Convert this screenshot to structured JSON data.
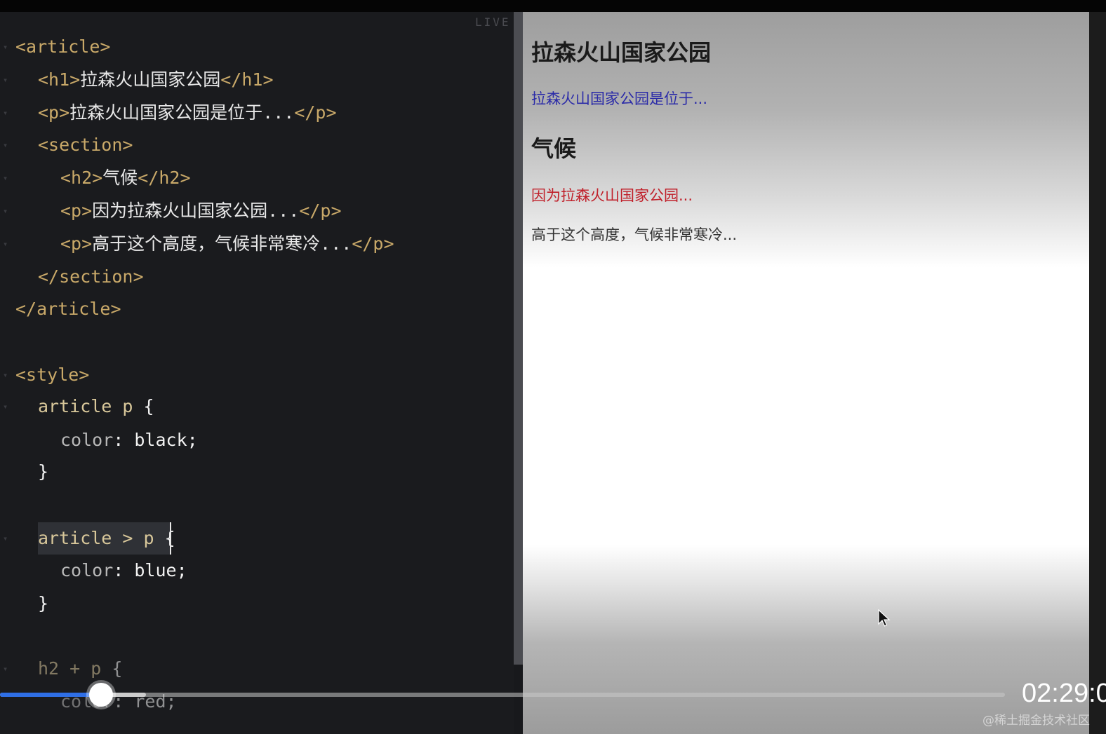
{
  "editor": {
    "live_label": "LIVE",
    "lines": [
      {
        "segments": [
          {
            "t": "<article>",
            "c": "c-tag"
          }
        ]
      },
      {
        "segments": [
          {
            "t": "<h1>",
            "c": "c-tag"
          },
          {
            "t": "拉森火山国家公园",
            "c": "c-txt"
          },
          {
            "t": "</h1>",
            "c": "c-tag"
          }
        ]
      },
      {
        "segments": [
          {
            "t": "<p>",
            "c": "c-tag"
          },
          {
            "t": "拉森火山国家公园是位于...",
            "c": "c-txt"
          },
          {
            "t": "</p>",
            "c": "c-tag"
          }
        ]
      },
      {
        "segments": [
          {
            "t": "<section>",
            "c": "c-tag"
          }
        ]
      },
      {
        "segments": [
          {
            "t": "<h2>",
            "c": "c-tag"
          },
          {
            "t": "气候",
            "c": "c-txt"
          },
          {
            "t": "</h2>",
            "c": "c-tag"
          }
        ]
      },
      {
        "segments": [
          {
            "t": "<p>",
            "c": "c-tag"
          },
          {
            "t": "因为拉森火山国家公园...",
            "c": "c-txt"
          },
          {
            "t": "</p>",
            "c": "c-tag"
          }
        ]
      },
      {
        "segments": [
          {
            "t": "<p>",
            "c": "c-tag"
          },
          {
            "t": "高于这个高度，气候非常寒冷...",
            "c": "c-txt"
          },
          {
            "t": "</p>",
            "c": "c-tag"
          }
        ]
      },
      {
        "segments": [
          {
            "t": "</section>",
            "c": "c-tag"
          }
        ]
      },
      {
        "segments": [
          {
            "t": "</article>",
            "c": "c-tag"
          }
        ]
      },
      {
        "segments": [
          {
            "t": "<style>",
            "c": "c-tag"
          }
        ]
      },
      {
        "segments": [
          {
            "t": "article p ",
            "c": "c-sel"
          },
          {
            "t": "{",
            "c": "c-brace"
          }
        ]
      },
      {
        "segments": [
          {
            "t": "color",
            "c": "c-prop"
          },
          {
            "t": ": ",
            "c": "c-brace"
          },
          {
            "t": "black;",
            "c": "c-val"
          }
        ]
      },
      {
        "segments": [
          {
            "t": "}",
            "c": "c-brace"
          }
        ]
      },
      {
        "segments": [
          {
            "t": "article > p ",
            "c": "c-sel"
          },
          {
            "t": "{",
            "c": "c-brace"
          }
        ]
      },
      {
        "segments": [
          {
            "t": "color",
            "c": "c-prop"
          },
          {
            "t": ": ",
            "c": "c-brace"
          },
          {
            "t": "blue;",
            "c": "c-val"
          }
        ]
      },
      {
        "segments": [
          {
            "t": "}",
            "c": "c-brace"
          }
        ]
      },
      {
        "segments": [
          {
            "t": "h2 + p ",
            "c": "c-sel"
          },
          {
            "t": "{",
            "c": "c-brace"
          }
        ]
      },
      {
        "segments": [
          {
            "t": "color",
            "c": "c-prop"
          },
          {
            "t": ": ",
            "c": "c-brace"
          },
          {
            "t": "red;",
            "c": "c-val"
          }
        ]
      }
    ]
  },
  "preview": {
    "h1": "拉森火山国家公园",
    "p1": "拉森火山国家公园是位于...",
    "h2": "气候",
    "p2": "因为拉森火山国家公园...",
    "p3": "高于这个高度，气候非常寒冷..."
  },
  "player": {
    "time": "02:29:0",
    "progress": 0.095,
    "buffered": 0.145,
    "progress_color": "#2f6fe6"
  },
  "watermark": "@稀土掘金技术社区"
}
